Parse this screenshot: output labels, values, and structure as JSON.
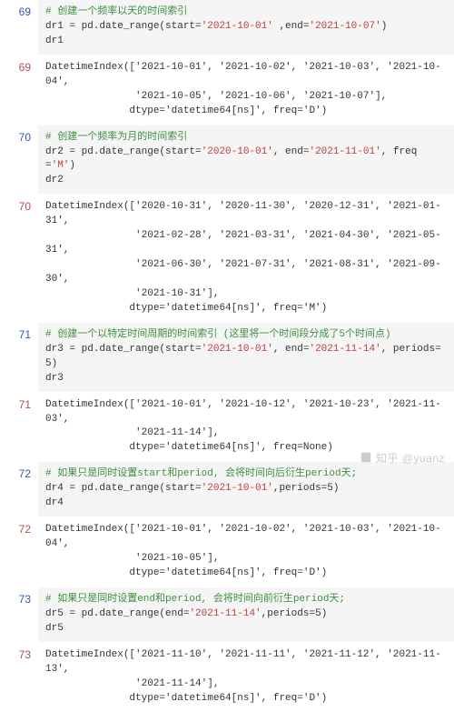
{
  "cells": [
    {
      "n": "69",
      "type": "input",
      "lines": [
        {
          "segs": [
            {
              "t": "# 创建一个频率以天的时间索引",
              "cls": "c-comment"
            }
          ]
        },
        {
          "segs": [
            {
              "t": "dr1 = pd.date_range(start="
            },
            {
              "t": "'2021-10-01'",
              "cls": "c-str"
            },
            {
              "t": " ,end="
            },
            {
              "t": "'2021-10-07'",
              "cls": "c-str"
            },
            {
              "t": ")"
            }
          ]
        },
        {
          "segs": [
            {
              "t": "dr1"
            }
          ]
        }
      ]
    },
    {
      "n": "69",
      "type": "output",
      "lines": [
        {
          "segs": [
            {
              "t": "DatetimeIndex(['2021-10-01', '2021-10-02', '2021-10-03', '2021-10-04',"
            }
          ]
        },
        {
          "segs": [
            {
              "t": "               '2021-10-05', '2021-10-06', '2021-10-07'],"
            }
          ]
        },
        {
          "segs": [
            {
              "t": "              dtype='datetime64[ns]', freq='D')"
            }
          ]
        }
      ]
    },
    {
      "n": "70",
      "type": "input",
      "lines": [
        {
          "segs": [
            {
              "t": "# 创建一个频率为月的时间索引",
              "cls": "c-comment"
            }
          ]
        },
        {
          "segs": [
            {
              "t": "dr2 = pd.date_range(start="
            },
            {
              "t": "'2020-10-01'",
              "cls": "c-str"
            },
            {
              "t": ", end="
            },
            {
              "t": "'2021-11-01'",
              "cls": "c-str"
            },
            {
              "t": ", freq="
            },
            {
              "t": "'M'",
              "cls": "c-str"
            },
            {
              "t": ")"
            }
          ]
        },
        {
          "segs": [
            {
              "t": "dr2"
            }
          ]
        }
      ]
    },
    {
      "n": "70",
      "type": "output",
      "lines": [
        {
          "segs": [
            {
              "t": "DatetimeIndex(['2020-10-31', '2020-11-30', '2020-12-31', '2021-01-31',"
            }
          ]
        },
        {
          "segs": [
            {
              "t": "               '2021-02-28', '2021-03-31', '2021-04-30', '2021-05-31',"
            }
          ]
        },
        {
          "segs": [
            {
              "t": "               '2021-06-30', '2021-07-31', '2021-08-31', '2021-09-30',"
            }
          ]
        },
        {
          "segs": [
            {
              "t": "               '2021-10-31'],"
            }
          ]
        },
        {
          "segs": [
            {
              "t": "              dtype='datetime64[ns]', freq='M')"
            }
          ]
        }
      ]
    },
    {
      "n": "71",
      "type": "input",
      "lines": [
        {
          "segs": [
            {
              "t": "# 创建一个以特定时间周期的时间索引 (这里将一个时间段分成了5个时间点)",
              "cls": "c-comment"
            }
          ]
        },
        {
          "segs": [
            {
              "t": "dr3 = pd.date_range(start="
            },
            {
              "t": "'2021-10-01'",
              "cls": "c-str"
            },
            {
              "t": ", end="
            },
            {
              "t": "'2021-11-14'",
              "cls": "c-str"
            },
            {
              "t": ", periods="
            },
            {
              "t": "5"
            },
            {
              "t": ")"
            }
          ]
        },
        {
          "segs": [
            {
              "t": "dr3"
            }
          ]
        }
      ]
    },
    {
      "n": "71",
      "type": "output",
      "lines": [
        {
          "segs": [
            {
              "t": "DatetimeIndex(['2021-10-01', '2021-10-12', '2021-10-23', '2021-11-03',"
            }
          ]
        },
        {
          "segs": [
            {
              "t": "               '2021-11-14'],"
            }
          ]
        },
        {
          "segs": [
            {
              "t": "              dtype='datetime64[ns]', freq=None)"
            }
          ]
        }
      ]
    },
    {
      "n": "72",
      "type": "input",
      "lines": [
        {
          "segs": [
            {
              "t": "# 如果只是同时设置start和period, 会将时间向后衍生period天;",
              "cls": "c-comment"
            }
          ]
        },
        {
          "segs": [
            {
              "t": "dr4 = pd.date_range(start="
            },
            {
              "t": "'2021-10-01'",
              "cls": "c-str"
            },
            {
              "t": ",periods="
            },
            {
              "t": "5"
            },
            {
              "t": ")"
            }
          ]
        },
        {
          "segs": [
            {
              "t": "dr4"
            }
          ]
        }
      ]
    },
    {
      "n": "72",
      "type": "output",
      "lines": [
        {
          "segs": [
            {
              "t": "DatetimeIndex(['2021-10-01', '2021-10-02', '2021-10-03', '2021-10-04',"
            }
          ]
        },
        {
          "segs": [
            {
              "t": "               '2021-10-05'],"
            }
          ]
        },
        {
          "segs": [
            {
              "t": "              dtype='datetime64[ns]', freq='D')"
            }
          ]
        }
      ]
    },
    {
      "n": "73",
      "type": "input",
      "lines": [
        {
          "segs": [
            {
              "t": "# 如果只是同时设置end和period, 会将时间向前衍生period天;",
              "cls": "c-comment"
            }
          ]
        },
        {
          "segs": [
            {
              "t": "dr5 = pd.date_range(end="
            },
            {
              "t": "'2021-11-14'",
              "cls": "c-str"
            },
            {
              "t": ",periods="
            },
            {
              "t": "5"
            },
            {
              "t": ")"
            }
          ]
        },
        {
          "segs": [
            {
              "t": "dr5"
            }
          ]
        }
      ]
    },
    {
      "n": "73",
      "type": "output",
      "lines": [
        {
          "segs": [
            {
              "t": "DatetimeIndex(['2021-11-10', '2021-11-11', '2021-11-12', '2021-11-13',"
            }
          ]
        },
        {
          "segs": [
            {
              "t": "               '2021-11-14'],"
            }
          ]
        },
        {
          "segs": [
            {
              "t": "              dtype='datetime64[ns]', freq='D')"
            }
          ]
        }
      ]
    }
  ],
  "watermark": "知乎 @yuanz"
}
